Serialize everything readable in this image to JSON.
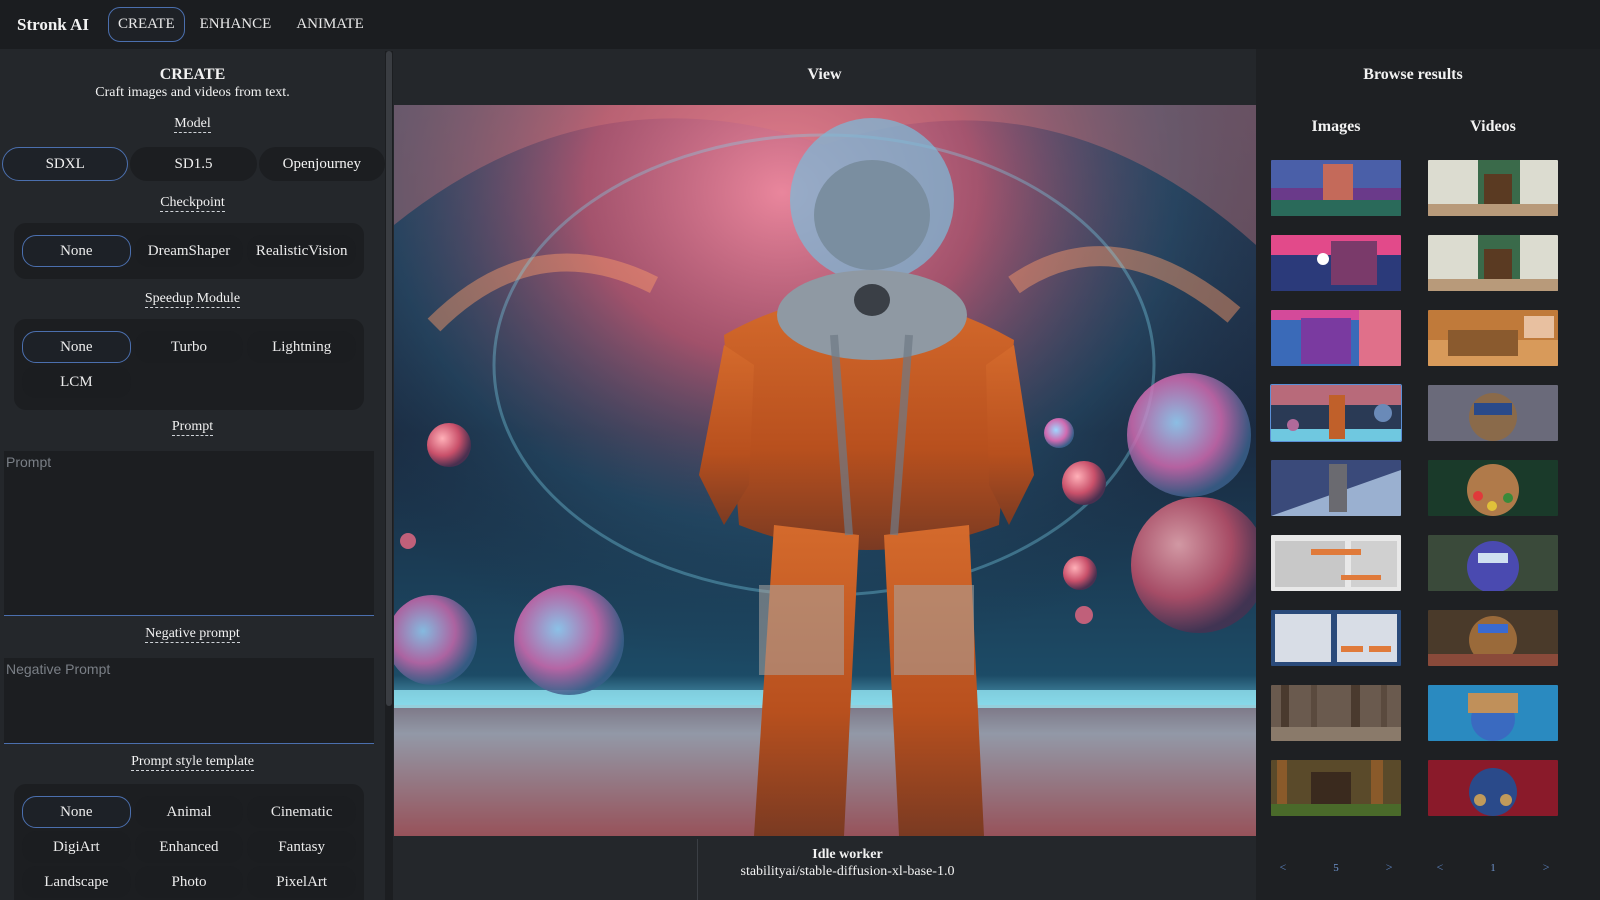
{
  "app": {
    "title": "Stronk AI"
  },
  "nav": {
    "tabs": [
      "CREATE",
      "ENHANCE",
      "ANIMATE"
    ],
    "active": "CREATE"
  },
  "create": {
    "title": "CREATE",
    "subtitle": "Craft images and videos from text.",
    "model": {
      "label": "Model",
      "options": [
        "SDXL",
        "SD1.5",
        "Openjourney"
      ],
      "selected": "SDXL"
    },
    "checkpoint": {
      "label": "Checkpoint",
      "options": [
        "None",
        "DreamShaper",
        "RealisticVision"
      ],
      "selected": "None"
    },
    "speedup": {
      "label": "Speedup Module",
      "options": [
        "None",
        "Turbo",
        "Lightning",
        "LCM"
      ],
      "selected": "None"
    },
    "prompt": {
      "label": "Prompt",
      "placeholder": "Prompt",
      "value": ""
    },
    "negative_prompt": {
      "label": "Negative prompt",
      "placeholder": "Negative Prompt",
      "value": ""
    },
    "style_template": {
      "label": "Prompt style template",
      "options": [
        "None",
        "Animal",
        "Cinematic",
        "DigiArt",
        "Enhanced",
        "Fantasy",
        "Landscape",
        "Photo",
        "PixelArt"
      ],
      "selected": "None"
    }
  },
  "view": {
    "title": "View",
    "status": "Idle worker",
    "model_path": "stabilityai/stable-diffusion-xl-base-1.0"
  },
  "browse": {
    "title": "Browse results",
    "images": {
      "label": "Images",
      "page": "5",
      "prev": "<",
      "next": ">",
      "count": 9,
      "selected_index": 3
    },
    "videos": {
      "label": "Videos",
      "page": "1",
      "prev": "<",
      "next": ">",
      "count": 9
    }
  },
  "colors": {
    "accent": "#4b6fae",
    "bg": "#1b1d20",
    "panel": "#24272b",
    "pager": "#5f87c7"
  }
}
